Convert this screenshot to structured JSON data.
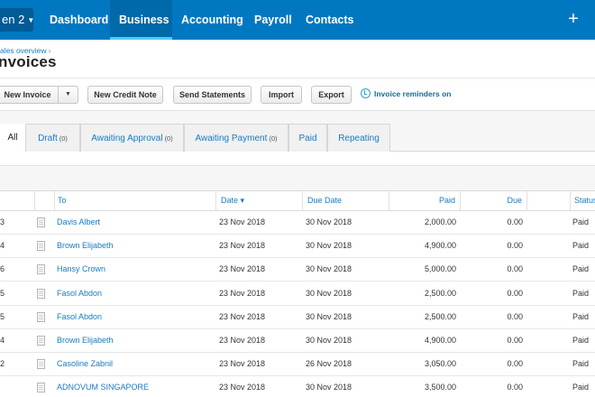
{
  "nav": {
    "org": "en 2",
    "items": [
      "Dashboard",
      "Business",
      "Accounting",
      "Payroll",
      "Contacts"
    ],
    "active": "Business",
    "plus": "+"
  },
  "page": {
    "breadcrumb": "ales overview",
    "breadcrumb_sep": "›",
    "title": "nvoices"
  },
  "toolbar": {
    "new_invoice": "New Invoice",
    "new_credit_note": "New Credit Note",
    "send_statements": "Send Statements",
    "import": "Import",
    "export": "Export",
    "reminder": "Invoice reminders on"
  },
  "tabs": [
    {
      "label": "All",
      "count": ""
    },
    {
      "label": "Draft",
      "count": "(0)"
    },
    {
      "label": "Awaiting Approval",
      "count": "(0)"
    },
    {
      "label": "Awaiting Payment",
      "count": "(0)"
    },
    {
      "label": "Paid",
      "count": ""
    },
    {
      "label": "Repeating",
      "count": ""
    }
  ],
  "table": {
    "columns": {
      "to": "To",
      "date": "Date ▾",
      "due_date": "Due Date",
      "paid": "Paid",
      "due": "Due",
      "status": "Status"
    },
    "rows": [
      {
        "num": "3",
        "to": "Davis Albert",
        "date": "23 Nov 2018",
        "due_date": "30 Nov 2018",
        "paid": "2,000.00",
        "due": "0.00",
        "status": "Paid"
      },
      {
        "num": "4",
        "to": "Brown Elijabeth",
        "date": "23 Nov 2018",
        "due_date": "30 Nov 2018",
        "paid": "4,900.00",
        "due": "0.00",
        "status": "Paid"
      },
      {
        "num": "6",
        "to": "Hansy Crown",
        "date": "23 Nov 2018",
        "due_date": "30 Nov 2018",
        "paid": "5,000.00",
        "due": "0.00",
        "status": "Paid"
      },
      {
        "num": "5",
        "to": "Fasol Abdon",
        "date": "23 Nov 2018",
        "due_date": "30 Nov 2018",
        "paid": "2,500.00",
        "due": "0.00",
        "status": "Paid"
      },
      {
        "num": "5",
        "to": "Fasol Abdon",
        "date": "23 Nov 2018",
        "due_date": "30 Nov 2018",
        "paid": "2,500.00",
        "due": "0.00",
        "status": "Paid"
      },
      {
        "num": "4",
        "to": "Brown Elijabeth",
        "date": "23 Nov 2018",
        "due_date": "30 Nov 2018",
        "paid": "4,900.00",
        "due": "0.00",
        "status": "Paid"
      },
      {
        "num": "2",
        "to": "Casoline Zabnil",
        "date": "23 Nov 2018",
        "due_date": "26 Nov 2018",
        "paid": "3,050.00",
        "due": "0.00",
        "status": "Paid"
      },
      {
        "num": "",
        "to": "ADNOVUM SINGAPORE",
        "date": "23 Nov 2018",
        "due_date": "30 Nov 2018",
        "paid": "3,500.00",
        "due": "0.00",
        "status": "Paid"
      }
    ]
  },
  "colors": {
    "nav_bg": "#0078c1",
    "nav_active": "#0069aa",
    "link": "#1a7bbf"
  }
}
